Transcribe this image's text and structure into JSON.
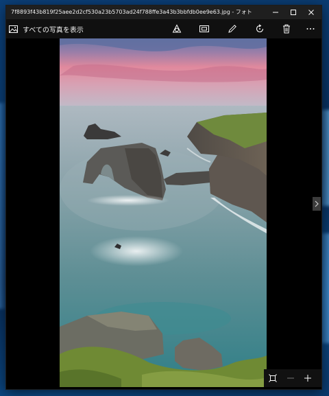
{
  "window": {
    "title": "7f8893f43b819f25aee2d2cf530a23b5703ad24f788ffe3a43b3bbfdb0ee9e63.jpg - フォト",
    "controls": {
      "minimize": "minimize",
      "maximize": "maximize",
      "close": "close"
    }
  },
  "appbar": {
    "back_label": "すべての写真を表示",
    "back_icon": "photo-collection-icon",
    "tools": [
      "enhance-icon",
      "slideshow-icon",
      "pencil-edit-icon",
      "rotate-icon",
      "delete-icon",
      "more-icon"
    ]
  },
  "photo": {
    "subject": "coastal-sea-stacks-long-exposure",
    "colors": {
      "sky_top": "#4a6fa8",
      "sky_glow": "#e98a9e",
      "sea": "#5f8e96",
      "grass": "#6e8a34"
    }
  },
  "navigation": {
    "next_icon": "chevron-right-icon"
  },
  "zoom": {
    "fit_icon": "fit-to-window-icon",
    "zoom_out_icon": "minus-icon",
    "zoom_in_icon": "plus-icon"
  },
  "colors": {
    "titlebar": "#1f1f1f",
    "appbar": "#101010",
    "window_bg": "#000000",
    "desktop": "#0a3c72"
  }
}
